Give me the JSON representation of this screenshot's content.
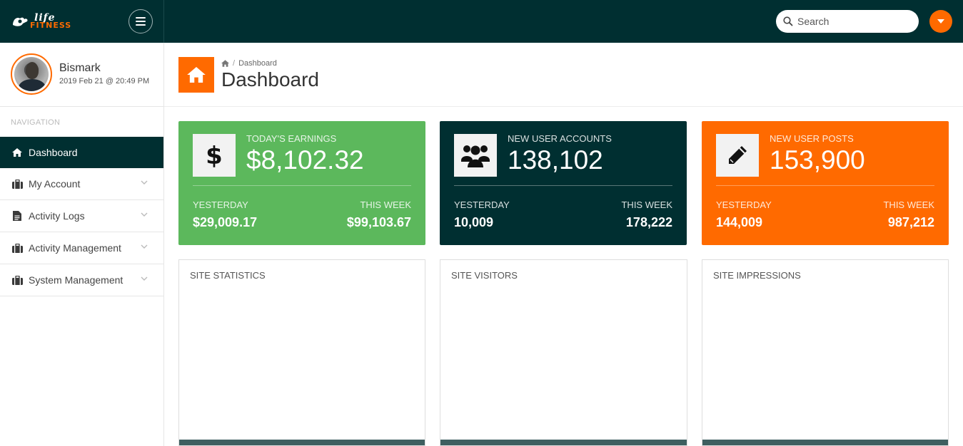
{
  "app": {
    "brand_script": "life",
    "brand_word": "FITNESS"
  },
  "topbar": {
    "search_placeholder": "Search"
  },
  "profile": {
    "name": "Bismark",
    "timestamp": "2019 Feb 21 @ 20:49 PM"
  },
  "sidebar": {
    "heading": "NAVIGATION",
    "items": [
      {
        "label": "Dashboard",
        "icon": "home-icon",
        "active": true
      },
      {
        "label": "My Account",
        "icon": "briefcase-icon",
        "has_children": true
      },
      {
        "label": "Activity Logs",
        "icon": "document-icon",
        "has_children": true
      },
      {
        "label": "Activity Management",
        "icon": "briefcase-icon",
        "has_children": true
      },
      {
        "label": "System Management",
        "icon": "briefcase-icon",
        "has_children": true
      }
    ]
  },
  "page": {
    "breadcrumb": "Dashboard",
    "title": "Dashboard"
  },
  "cards": [
    {
      "label": "TODAY'S EARNINGS",
      "value": "$8,102.32",
      "left_label": "YESTERDAY",
      "left_value": "$29,009.17",
      "right_label": "THIS WEEK",
      "right_value": "$99,103.67",
      "color": "#5cb85c",
      "icon": "dollar-icon"
    },
    {
      "label": "NEW USER ACCOUNTS",
      "value": "138,102",
      "left_label": "YESTERDAY",
      "left_value": "10,009",
      "right_label": "THIS WEEK",
      "right_value": "178,222",
      "color": "#002f31",
      "icon": "users-icon"
    },
    {
      "label": "NEW USER POSTS",
      "value": "153,900",
      "left_label": "YESTERDAY",
      "left_value": "144,009",
      "right_label": "THIS WEEK",
      "right_value": "987,212",
      "color": "#ff6a00",
      "icon": "pencil-icon"
    }
  ],
  "panels": [
    {
      "title": "SITE STATISTICS"
    },
    {
      "title": "SITE VISITORS"
    },
    {
      "title": "SITE IMPRESSIONS"
    }
  ],
  "colors": {
    "topbar": "#002f31",
    "accent": "#ff6a00",
    "success": "#5cb85c"
  }
}
